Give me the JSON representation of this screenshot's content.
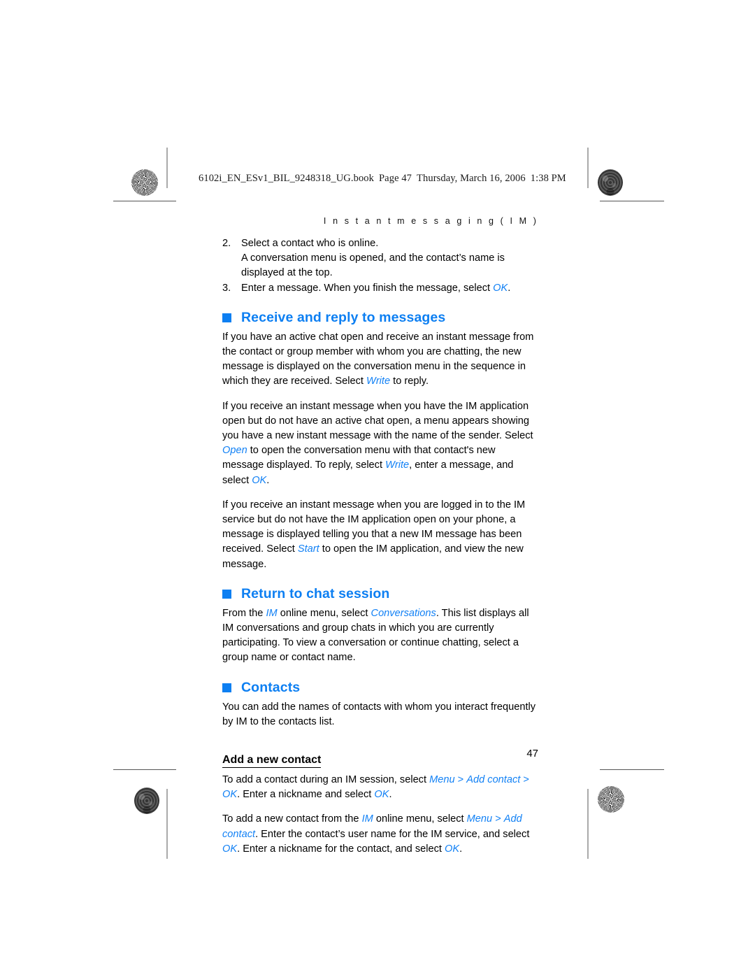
{
  "document": {
    "book_line": {
      "filename": "6102i_EN_ESv1_BIL_9248318_UG.book",
      "page_label": "Page 47",
      "day": "Thursday, March 16, 2006",
      "time": "1:38 PM"
    },
    "running_header": "I n s t a n t   m e s s a g i n g   ( I M )",
    "page_number": "47",
    "accent_color": "#0d7ff2",
    "ui_term_color": "#1281f5"
  },
  "content": {
    "steps": [
      {
        "number": "2.",
        "text": "Select a contact who is online.",
        "continuation": "A conversation menu is opened, and the contact’s name is displayed at the top."
      },
      {
        "number": "3.",
        "text_before": "Enter a message. When you finish the message, select ",
        "ui": "OK",
        "text_after": "."
      }
    ],
    "sections": [
      {
        "heading": "Receive and reply to messages",
        "paragraphs": [
          {
            "parts": [
              {
                "type": "text",
                "value": "If you have an active chat open and receive an instant message from the contact or group member with whom you are chatting, the new message is displayed on the conversation menu in the sequence in which they are received. Select "
              },
              {
                "type": "ui",
                "value": "Write"
              },
              {
                "type": "text",
                "value": " to reply."
              }
            ]
          },
          {
            "parts": [
              {
                "type": "text",
                "value": "If you receive an instant message when you have the IM application open but do not have an active chat open, a menu appears showing you have a new instant message with the name of the sender. Select "
              },
              {
                "type": "ui",
                "value": "Open"
              },
              {
                "type": "text",
                "value": " to open the conversation menu with that contact's new message displayed. To reply, select "
              },
              {
                "type": "ui",
                "value": "Write"
              },
              {
                "type": "text",
                "value": ", enter a message, and select "
              },
              {
                "type": "ui",
                "value": "OK"
              },
              {
                "type": "text",
                "value": "."
              }
            ]
          },
          {
            "parts": [
              {
                "type": "text",
                "value": "If you receive an instant message when you are logged in to the IM service but do not have the IM application open on your phone, a message is displayed telling you that a new IM message has been received. Select "
              },
              {
                "type": "ui",
                "value": "Start"
              },
              {
                "type": "text",
                "value": " to open the IM application, and view the new message."
              }
            ]
          }
        ]
      },
      {
        "heading": "Return to chat session",
        "paragraphs": [
          {
            "parts": [
              {
                "type": "text",
                "value": "From the "
              },
              {
                "type": "ui",
                "value": "IM"
              },
              {
                "type": "text",
                "value": " online menu, select "
              },
              {
                "type": "ui",
                "value": "Conversations"
              },
              {
                "type": "text",
                "value": ". This list displays all IM conversations and group chats in which you are currently participating. To view a conversation or continue chatting, select a group name or contact name."
              }
            ]
          }
        ]
      },
      {
        "heading": "Contacts",
        "paragraphs": [
          {
            "parts": [
              {
                "type": "text",
                "value": "You can add the names of contacts with whom you interact frequently by IM to the contacts list."
              }
            ]
          }
        ],
        "subsection": {
          "heading": "Add a new contact",
          "paragraphs": [
            {
              "parts": [
                {
                  "type": "text",
                  "value": "To add a contact during an IM session, select "
                },
                {
                  "type": "ui",
                  "value": "Menu"
                },
                {
                  "type": "plain",
                  "value": " > "
                },
                {
                  "type": "ui",
                  "value": "Add contact"
                },
                {
                  "type": "plain",
                  "value": " > "
                },
                {
                  "type": "ui",
                  "value": "OK"
                },
                {
                  "type": "text",
                  "value": ". Enter a nickname and select "
                },
                {
                  "type": "ui",
                  "value": "OK"
                },
                {
                  "type": "text",
                  "value": "."
                }
              ]
            },
            {
              "parts": [
                {
                  "type": "text",
                  "value": "To add a new contact from the "
                },
                {
                  "type": "ui",
                  "value": "IM"
                },
                {
                  "type": "text",
                  "value": " online menu, select "
                },
                {
                  "type": "ui",
                  "value": "Menu"
                },
                {
                  "type": "plain",
                  "value": " > "
                },
                {
                  "type": "ui",
                  "value": "Add contact"
                },
                {
                  "type": "text",
                  "value": ". Enter the contact’s user name for the IM service, and select "
                },
                {
                  "type": "ui",
                  "value": "OK"
                },
                {
                  "type": "text",
                  "value": ". Enter a nickname for the contact, and select "
                },
                {
                  "type": "ui",
                  "value": "OK"
                },
                {
                  "type": "text",
                  "value": "."
                }
              ]
            }
          ]
        }
      }
    ]
  }
}
